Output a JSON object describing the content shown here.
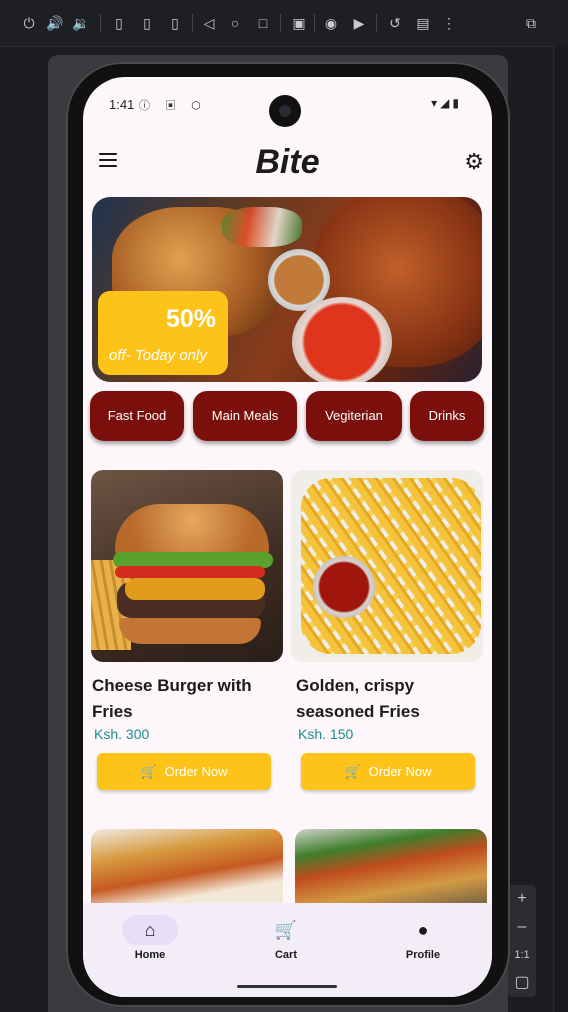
{
  "emulator": {
    "toolbar_icons": [
      "power-icon",
      "volume-up-icon",
      "volume-down-icon",
      "rotate-left-icon",
      "rotate-right-icon",
      "device-icon",
      "back-icon",
      "home-icon",
      "overview-icon",
      "snapshot-icon",
      "camera-icon",
      "record-icon",
      "undo-icon",
      "extended-controls-icon",
      "more-icon",
      "inspect-icon"
    ],
    "side_panel": {
      "zoom_label": "1:1"
    }
  },
  "status_bar": {
    "time": "1:41"
  },
  "app_bar": {
    "title": "Bite"
  },
  "banner": {
    "discount": "50%",
    "caption": "off- Today only"
  },
  "categories": [
    {
      "label": "Fast Food"
    },
    {
      "label": "Main Meals"
    },
    {
      "label": "Vegiterian"
    },
    {
      "label": "Drinks"
    }
  ],
  "products": [
    {
      "name": "Cheese Burger with Fries",
      "price": "Ksh. 300",
      "button": "Order Now"
    },
    {
      "name": "Golden, crispy seasoned Fries",
      "price": "Ksh. 150",
      "button": "Order Now"
    }
  ],
  "bottom_nav": [
    {
      "label": "Home",
      "icon": "home-icon",
      "active": true
    },
    {
      "label": "Cart",
      "icon": "cart-icon",
      "active": false
    },
    {
      "label": "Profile",
      "icon": "person-icon",
      "active": false
    }
  ],
  "colors": {
    "accent_yellow": "#fdc318",
    "category_red": "#7b0f0b",
    "price_teal": "#1c8c8c",
    "nav_active": "#e8def8"
  }
}
